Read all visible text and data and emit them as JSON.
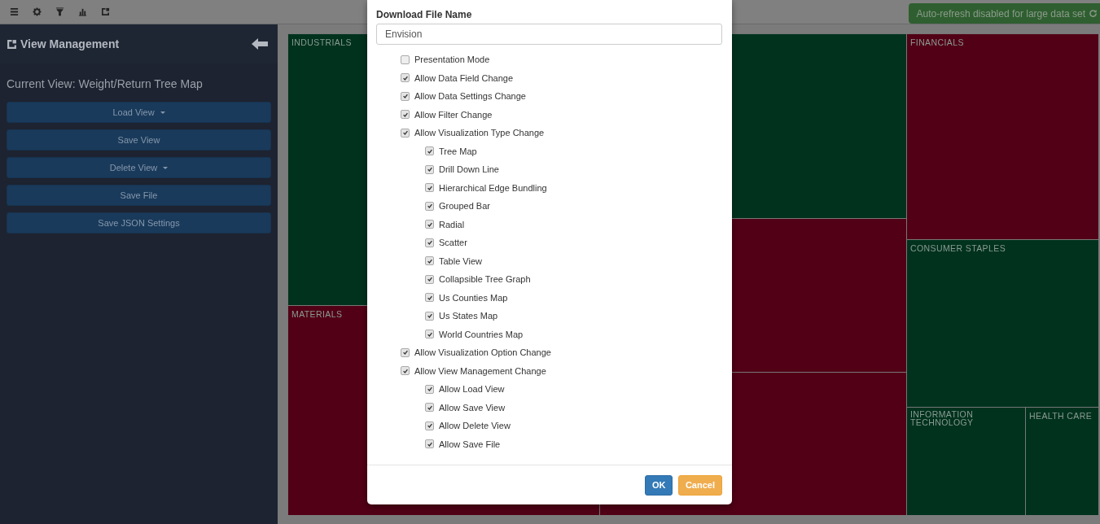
{
  "toolbar": {
    "notice": "Auto-refresh disabled for large data set"
  },
  "sidebar": {
    "title": "View Management",
    "current_view": "Current View: Weight/Return Tree Map",
    "buttons": [
      {
        "label": "Load View",
        "dropdown": true
      },
      {
        "label": "Save View",
        "dropdown": false
      },
      {
        "label": "Delete View",
        "dropdown": true
      },
      {
        "label": "Save File",
        "dropdown": false
      },
      {
        "label": "Save JSON Settings",
        "dropdown": false
      }
    ]
  },
  "treemap": {
    "tiles": [
      {
        "label": "INDUSTRIALS",
        "color": "#00321e"
      },
      {
        "color": "#00321e"
      },
      {
        "color": "#520016"
      },
      {
        "color": "#520016"
      },
      {
        "label": "MATERIALS",
        "color": "#520016"
      },
      {
        "label": "FINANCIALS",
        "color": "#520016"
      },
      {
        "label": "CONSUMER STAPLES",
        "color": "#00321e"
      },
      {
        "label": "INFORMATION TECHNOLOGY",
        "color": "#00321e"
      },
      {
        "label": "HEALTH CARE",
        "color": "#00321e"
      }
    ]
  },
  "dialog": {
    "field_label": "Download File Name",
    "file_name": "Envision",
    "options": [
      {
        "label": "Presentation Mode",
        "checked": false
      },
      {
        "label": "Allow Data Field Change",
        "checked": true
      },
      {
        "label": "Allow Data Settings Change",
        "checked": true
      },
      {
        "label": "Allow Filter Change",
        "checked": true
      },
      {
        "label": "Allow Visualization Type Change",
        "checked": true,
        "children": [
          {
            "label": "Tree Map",
            "checked": true
          },
          {
            "label": "Drill Down Line",
            "checked": true
          },
          {
            "label": "Hierarchical Edge Bundling",
            "checked": true
          },
          {
            "label": "Grouped Bar",
            "checked": true
          },
          {
            "label": "Radial",
            "checked": true
          },
          {
            "label": "Scatter",
            "checked": true
          },
          {
            "label": "Table View",
            "checked": true
          },
          {
            "label": "Collapsible Tree Graph",
            "checked": true
          },
          {
            "label": "Us Counties Map",
            "checked": true
          },
          {
            "label": "Us States Map",
            "checked": true
          },
          {
            "label": "World Countries Map",
            "checked": true
          }
        ]
      },
      {
        "label": "Allow Visualization Option Change",
        "checked": true
      },
      {
        "label": "Allow View Management Change",
        "checked": true,
        "children": [
          {
            "label": "Allow Load View",
            "checked": true
          },
          {
            "label": "Allow Save View",
            "checked": true
          },
          {
            "label": "Allow Delete View",
            "checked": true
          },
          {
            "label": "Allow Save File",
            "checked": true
          }
        ]
      }
    ],
    "buttons": [
      {
        "label": "OK",
        "kind": "primary"
      },
      {
        "label": "Cancel",
        "kind": "warning"
      }
    ]
  }
}
